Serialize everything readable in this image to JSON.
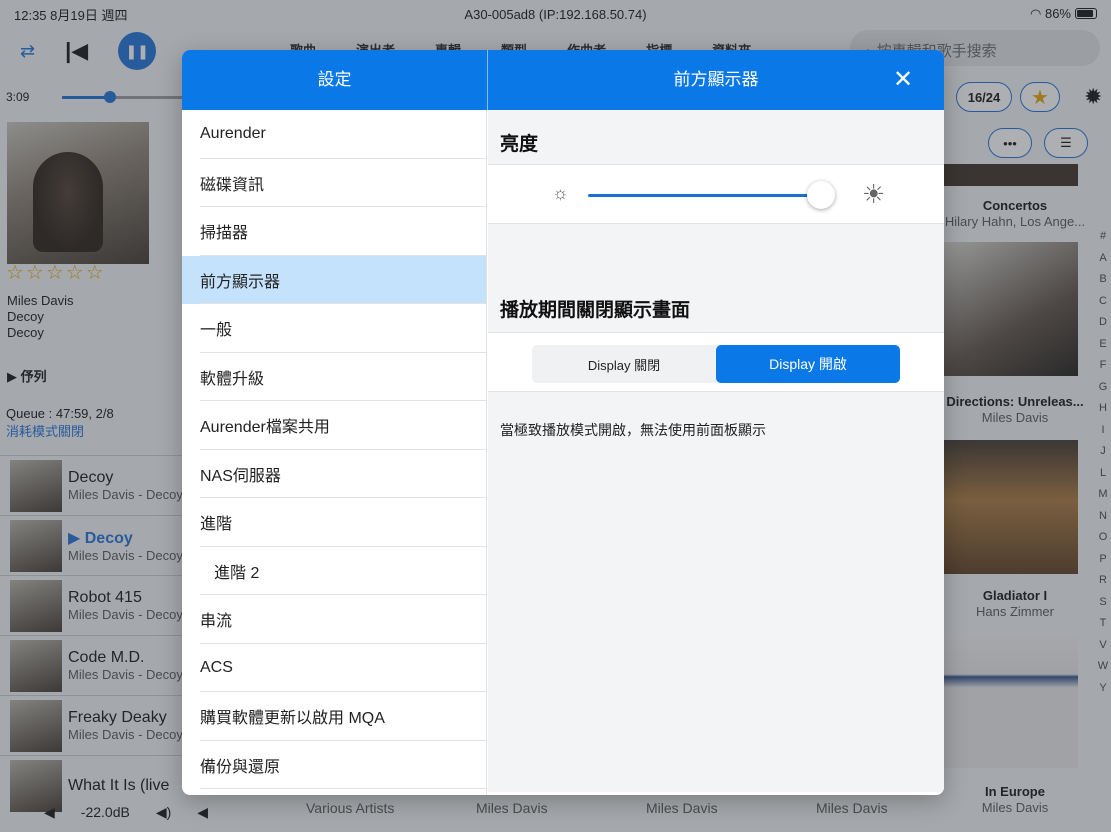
{
  "status_bar": {
    "time_date": "12:35  8月19日 週四",
    "device": "A30-005ad8 (IP:192.168.50.74)",
    "wifi_battery": "86%"
  },
  "player": {
    "elapsed": "3:09",
    "progress_fraction": 0.4,
    "artist": "Miles Davis",
    "album": "Decoy",
    "track": "Decoy",
    "queue_label": "伃列",
    "queue_summary": "Queue : 47:59, 2/8",
    "consume_mode": "消耗模式關閉",
    "volume": "-22.0dB",
    "rating_stars": "☆☆☆☆☆"
  },
  "library_tabs": [
    "歌曲",
    "演出者",
    "專輯",
    "類型",
    "作曲者",
    "指標",
    "資料夾"
  ],
  "search": {
    "placeholder": "按專輯和歌手搜索"
  },
  "page_counter": "16/24",
  "queue": [
    {
      "title": "Decoy",
      "subtitle": "Miles Davis - Decoy",
      "active": false
    },
    {
      "title": "Decoy",
      "subtitle": "Miles Davis - Decoy",
      "active": true
    },
    {
      "title": "Robot 415",
      "subtitle": "Miles Davis - Decoy",
      "active": false
    },
    {
      "title": "Code M.D.",
      "subtitle": "Miles Davis - Decoy",
      "active": false
    },
    {
      "title": "Freaky Deaky",
      "subtitle": "Miles Davis - Decoy",
      "active": false
    },
    {
      "title": "What It Is (live",
      "subtitle": "",
      "active": false
    }
  ],
  "gallery": [
    {
      "title": "Concertos",
      "artist": "Hilary Hahn, Los Ange..."
    },
    {
      "title": "Directions: Unreleas...",
      "artist": "Miles Davis"
    },
    {
      "title": "Gladiator I",
      "artist": "Hans Zimmer"
    },
    {
      "title": "In Europe",
      "artist": "Miles Davis"
    }
  ],
  "bottom_artists": [
    "Various Artists",
    "Miles Davis",
    "Miles Davis",
    "Miles Davis"
  ],
  "alphabet": [
    "#",
    "A",
    "B",
    "C",
    "D",
    "E",
    "F",
    "G",
    "H",
    "I",
    "J",
    "L",
    "M",
    "N",
    "O",
    "P",
    "R",
    "S",
    "T",
    "V",
    "W",
    "Y"
  ],
  "settings": {
    "title": "設定",
    "menu": [
      {
        "label": "Aurender",
        "selected": false
      },
      {
        "label": "磁碟資訊",
        "selected": false
      },
      {
        "label": "掃描器",
        "selected": false
      },
      {
        "label": "前方顯示器",
        "selected": true
      },
      {
        "label": "一般",
        "selected": false
      },
      {
        "label": "軟體升級",
        "selected": false
      },
      {
        "label": "Aurender檔案共用",
        "selected": false
      },
      {
        "label": "NAS伺服器",
        "selected": false
      },
      {
        "label": "進階",
        "selected": false
      },
      {
        "label": "進階 2",
        "selected": false
      },
      {
        "label": "串流",
        "selected": false
      },
      {
        "label": "ACS",
        "selected": false
      },
      {
        "label": "購買軟體更新以啟用 MQA",
        "selected": false
      },
      {
        "label": "備份與還原",
        "selected": false
      }
    ],
    "pane": {
      "title": "前方顯示器",
      "brightness_label": "亮度",
      "brightness_value": 0.97,
      "off_section_label": "播放期間關閉顯示畫面",
      "option_off": "Display 關閉",
      "option_on": "Display 開啟",
      "selected_option": "on",
      "note": "當極致播放模式開啟，無法使用前面板顯示"
    }
  },
  "colors": {
    "accent": "#0a78e6",
    "selected_row": "#c4e2fb"
  }
}
